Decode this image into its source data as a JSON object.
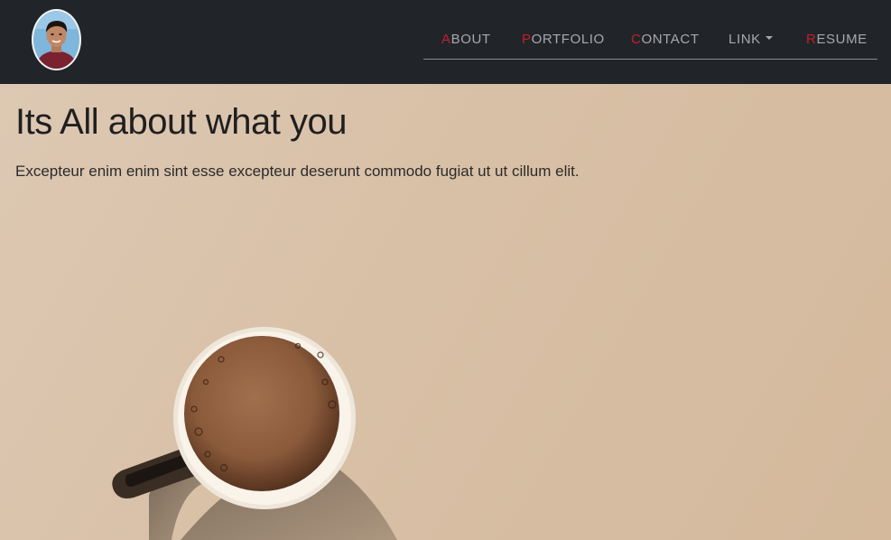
{
  "navbar": {
    "items": [
      {
        "first": "A",
        "rest": "BOUT"
      },
      {
        "first": "P",
        "rest": "ORTFOLIO"
      },
      {
        "first": "C",
        "rest": "ONTACT"
      },
      {
        "first": "",
        "rest": "LINK"
      },
      {
        "first": "R",
        "rest": "ESUME"
      }
    ],
    "accent_color": "#c41f2a",
    "background": "#212529"
  },
  "hero": {
    "title": "Its All about what you",
    "subtitle": "Excepteur enim enim sint esse excepteur deserunt commodo fugiat ut ut cillum elit."
  }
}
